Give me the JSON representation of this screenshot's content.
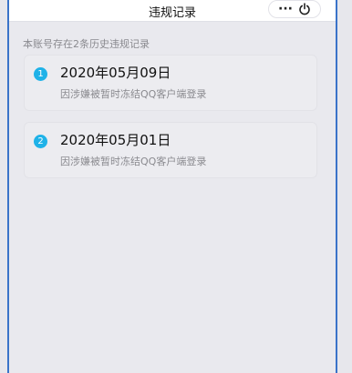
{
  "header": {
    "title": "违规记录",
    "more_icon": "more-dots-icon",
    "power_icon": "power-icon",
    "more_glyph": "···"
  },
  "summary": "本账号存在2条历史违规记录",
  "records": [
    {
      "index": "1",
      "date": "2020年05月09日",
      "reason": "因涉嫌被暂时冻结QQ客户端登录"
    },
    {
      "index": "2",
      "date": "2020年05月01日",
      "reason": "因涉嫌被暂时冻结QQ客户端登录"
    }
  ],
  "colors": {
    "accent": "#1fb2e8",
    "frame_border": "#3a73c9",
    "background": "#e9e9ee"
  }
}
